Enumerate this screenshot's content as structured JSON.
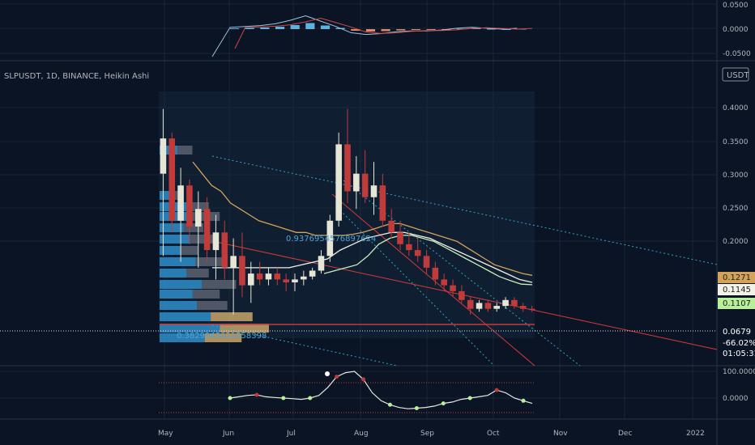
{
  "header": {
    "title": "SLPUSDT, 1D, BINANCE, Heikin Ashi",
    "currency_badge": "USDT"
  },
  "colors": {
    "background": "#0b1424",
    "grid": "#1a2436",
    "up_candle": "#e6e6d6",
    "down_candle": "#c23b3b",
    "ma_orange": "#d4a35a",
    "ma_white": "#f2f2e6",
    "ma_green": "#c8f0c0",
    "channel_cyan": "#2aa7c9",
    "channel_red": "#d63a3a",
    "price_line": "#dddddd"
  },
  "price_labels": [
    {
      "text": "0.1271",
      "bg": "#d4a35a",
      "fg": "#1b1b1b"
    },
    {
      "text": "0.1145",
      "bg": "#f2f2e6",
      "fg": "#1b1b1b"
    },
    {
      "text": "0.1107",
      "bg": "#b7ef9a",
      "fg": "#1b1b1b"
    },
    {
      "text": "0.0679",
      "bg": "#0b1424",
      "fg": "#ffffff"
    },
    {
      "text": "-66.02%",
      "bg": "#0b1424",
      "fg": "#ffffff"
    },
    {
      "text": "01:05:31",
      "bg": "#0b1424",
      "fg": "#ffffff"
    }
  ],
  "annotations": {
    "fib_upper": "0.9376954576897624",
    "fib_lower": "0.3829943021558398"
  },
  "chart_data": [
    {
      "type": "bar",
      "panel": "macd",
      "title": "",
      "ylim": [
        -0.06,
        0.06
      ],
      "y_ticks": [
        "0.0500",
        "0.0000",
        "-0.0500"
      ],
      "series": [
        {
          "values": [
            0.002,
            0.003,
            0.004,
            0.006,
            0.01,
            0.015,
            0.009,
            0.003,
            -0.004,
            -0.006,
            -0.005,
            -0.003,
            -0.002,
            -0.002,
            -0.001,
            0.001,
            0.002,
            0.001,
            0.0,
            0.001
          ]
        }
      ]
    },
    {
      "type": "line",
      "panel": "price",
      "ylim": [
        0.02,
        0.44
      ],
      "y_ticks": [
        "0.4000",
        "0.3500",
        "0.3000",
        "0.2500",
        "0.2000"
      ],
      "x_ticks": [
        "May",
        "Jun",
        "Jul",
        "Aug",
        "Sep",
        "Oct",
        "Nov",
        "Dec",
        "2022"
      ],
      "candles": [
        [
          0.3,
          0.41,
          0.16,
          0.36
        ],
        [
          0.36,
          0.37,
          0.2,
          0.22
        ],
        [
          0.22,
          0.31,
          0.15,
          0.28
        ],
        [
          0.28,
          0.29,
          0.18,
          0.21
        ],
        [
          0.21,
          0.27,
          0.14,
          0.24
        ],
        [
          0.24,
          0.26,
          0.15,
          0.17
        ],
        [
          0.17,
          0.23,
          0.12,
          0.2
        ],
        [
          0.2,
          0.22,
          0.12,
          0.14
        ],
        [
          0.14,
          0.19,
          0.06,
          0.16
        ],
        [
          0.16,
          0.2,
          0.09,
          0.11
        ],
        [
          0.11,
          0.15,
          0.08,
          0.13
        ],
        [
          0.13,
          0.15,
          0.11,
          0.12
        ],
        [
          0.12,
          0.14,
          0.11,
          0.13
        ],
        [
          0.13,
          0.14,
          0.11,
          0.12
        ],
        [
          0.12,
          0.13,
          0.1,
          0.115
        ],
        [
          0.115,
          0.13,
          0.1,
          0.12
        ],
        [
          0.12,
          0.135,
          0.11,
          0.125
        ],
        [
          0.125,
          0.14,
          0.12,
          0.135
        ],
        [
          0.135,
          0.17,
          0.13,
          0.16
        ],
        [
          0.16,
          0.23,
          0.15,
          0.22
        ],
        [
          0.22,
          0.37,
          0.21,
          0.35
        ],
        [
          0.35,
          0.41,
          0.25,
          0.27
        ],
        [
          0.27,
          0.33,
          0.24,
          0.3
        ],
        [
          0.3,
          0.34,
          0.25,
          0.26
        ],
        [
          0.26,
          0.32,
          0.23,
          0.28
        ],
        [
          0.28,
          0.3,
          0.21,
          0.22
        ],
        [
          0.22,
          0.24,
          0.19,
          0.2
        ],
        [
          0.2,
          0.22,
          0.17,
          0.18
        ],
        [
          0.18,
          0.2,
          0.16,
          0.17
        ],
        [
          0.17,
          0.19,
          0.15,
          0.16
        ],
        [
          0.16,
          0.17,
          0.13,
          0.14
        ],
        [
          0.14,
          0.15,
          0.11,
          0.12
        ],
        [
          0.12,
          0.13,
          0.1,
          0.11
        ],
        [
          0.11,
          0.12,
          0.09,
          0.1
        ],
        [
          0.1,
          0.11,
          0.08,
          0.085
        ],
        [
          0.085,
          0.09,
          0.06,
          0.07
        ],
        [
          0.07,
          0.085,
          0.065,
          0.08
        ],
        [
          0.08,
          0.085,
          0.065,
          0.07
        ],
        [
          0.07,
          0.08,
          0.065,
          0.075
        ],
        [
          0.075,
          0.09,
          0.07,
          0.085
        ],
        [
          0.085,
          0.09,
          0.07,
          0.075
        ],
        [
          0.075,
          0.08,
          0.065,
          0.07
        ],
        [
          0.07,
          0.075,
          0.065,
          0.068
        ]
      ],
      "series": [
        {
          "values": [
            0.32,
            0.3,
            0.28,
            0.27,
            0.25,
            0.24,
            0.23,
            0.22,
            0.215,
            0.21,
            0.205,
            0.2,
            0.2,
            0.195,
            0.195,
            0.195,
            0.195,
            0.197,
            0.2,
            0.205,
            0.21,
            0.215,
            0.215,
            0.21,
            0.205,
            0.2,
            0.195,
            0.19,
            0.185,
            0.175,
            0.165,
            0.155,
            0.145,
            0.14,
            0.135,
            0.13,
            0.127
          ]
        },
        {
          "values": [
            0.14,
            0.14,
            0.14,
            0.14,
            0.14,
            0.14,
            0.14,
            0.145,
            0.15,
            0.155,
            0.17,
            0.18,
            0.19,
            0.195,
            0.2,
            0.2,
            0.195,
            0.19,
            0.18,
            0.17,
            0.16,
            0.15,
            0.14,
            0.13,
            0.12,
            0.115
          ]
        },
        {
          "values": [
            0.13,
            0.135,
            0.14,
            0.145,
            0.16,
            0.18,
            0.19,
            0.195,
            0.195,
            0.19,
            0.185,
            0.175,
            0.165,
            0.155,
            0.145,
            0.135,
            0.125,
            0.118,
            0.112,
            0.111
          ]
        }
      ]
    },
    {
      "type": "line",
      "panel": "oscillator",
      "ylim": [
        -100,
        100
      ],
      "y_ticks": [
        "100.0000",
        "0.0000"
      ],
      "series": [
        {
          "values": [
            0,
            5,
            10,
            12,
            5,
            2,
            0,
            -2,
            -5,
            0,
            10,
            40,
            80,
            95,
            100,
            70,
            20,
            -10,
            -25,
            -35,
            -40,
            -38,
            -35,
            -30,
            -20,
            -15,
            -5,
            0,
            5,
            10,
            30,
            20,
            0,
            -10,
            -20
          ]
        }
      ]
    }
  ]
}
